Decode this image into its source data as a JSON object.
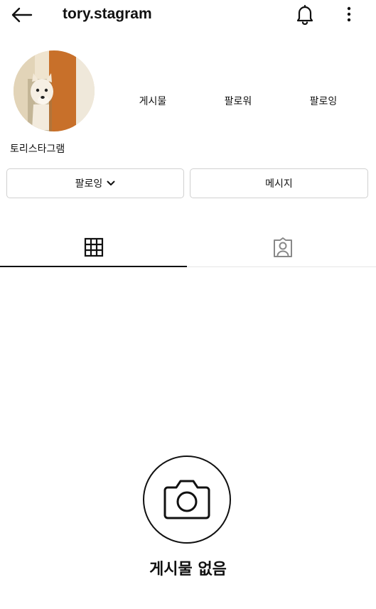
{
  "header": {
    "username": "tory.stagram",
    "back_icon": "arrow-left-icon",
    "bell_icon": "bell-icon",
    "more_icon": "more-vertical-icon"
  },
  "profile": {
    "display_name": "토리스타그램",
    "stats": [
      {
        "label": "게시물"
      },
      {
        "label": "팔로워"
      },
      {
        "label": "팔로잉"
      }
    ]
  },
  "actions": {
    "following_label": "팔로잉",
    "message_label": "메시지"
  },
  "tabs": [
    {
      "icon": "grid-icon",
      "active": true
    },
    {
      "icon": "tagged-user-icon",
      "active": false
    }
  ],
  "empty_state": {
    "icon": "camera-icon",
    "text": "게시물 없음"
  }
}
